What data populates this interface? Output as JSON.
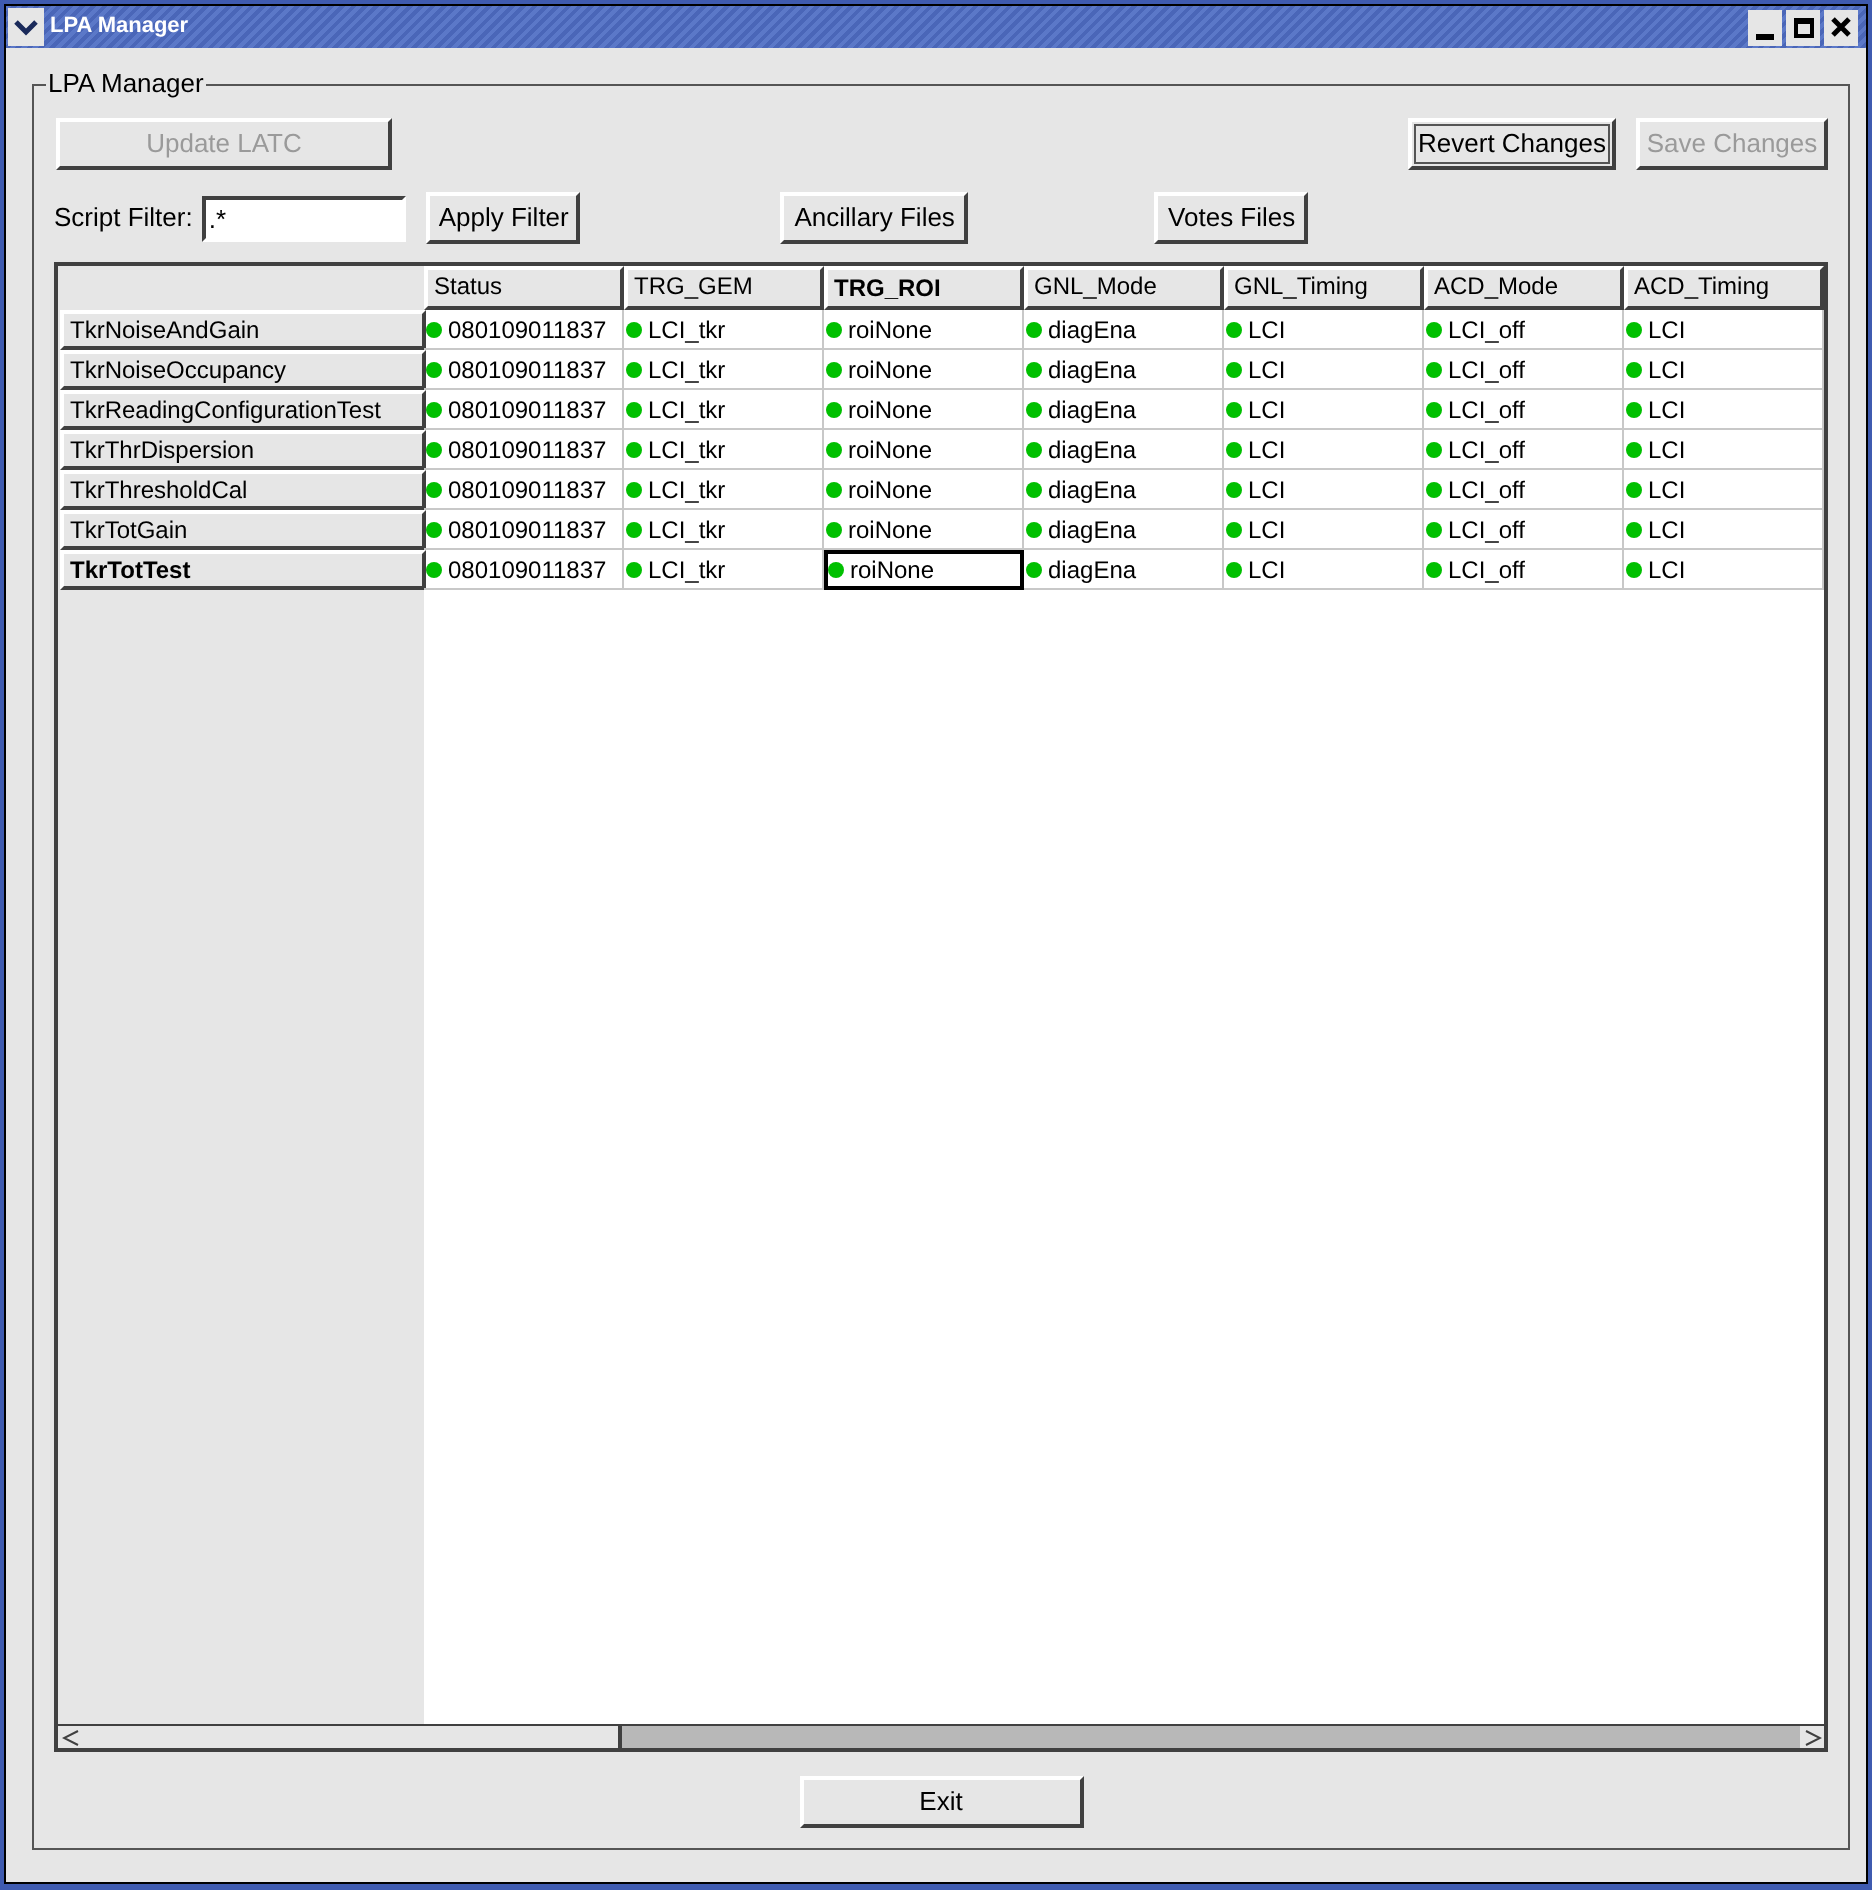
{
  "window": {
    "title": "LPA Manager"
  },
  "group": {
    "title": "LPA Manager"
  },
  "top_buttons": [
    {
      "label": "Update LATC",
      "disabled": true,
      "default": false
    },
    {
      "label": "Revert Changes",
      "disabled": false,
      "default": true
    },
    {
      "label": "Save Changes",
      "disabled": true,
      "default": false
    }
  ],
  "filter": {
    "label": "Script Filter:",
    "value": ".*"
  },
  "filter_buttons": [
    "Apply Filter",
    "Ancillary Files",
    "Votes Files"
  ],
  "table": {
    "columns": [
      {
        "label": "Status",
        "selected": false
      },
      {
        "label": "TRG_GEM",
        "selected": false
      },
      {
        "label": "TRG_ROI",
        "selected": true
      },
      {
        "label": "GNL_Mode",
        "selected": false
      },
      {
        "label": "GNL_Timing",
        "selected": false
      },
      {
        "label": "ACD_Mode",
        "selected": false
      },
      {
        "label": "ACD_Timing",
        "selected": false
      }
    ],
    "rows": [
      {
        "name": "TkrNoiseAndGain",
        "selected": false,
        "cells": [
          {
            "text": "080109011837",
            "selected": false
          },
          {
            "text": "LCI_tkr",
            "selected": false
          },
          {
            "text": "roiNone",
            "selected": false
          },
          {
            "text": "diagEna",
            "selected": false
          },
          {
            "text": "LCI",
            "selected": false
          },
          {
            "text": "LCI_off",
            "selected": false
          },
          {
            "text": "LCI",
            "selected": false
          }
        ]
      },
      {
        "name": "TkrNoiseOccupancy",
        "selected": false,
        "cells": [
          {
            "text": "080109011837",
            "selected": false
          },
          {
            "text": "LCI_tkr",
            "selected": false
          },
          {
            "text": "roiNone",
            "selected": false
          },
          {
            "text": "diagEna",
            "selected": false
          },
          {
            "text": "LCI",
            "selected": false
          },
          {
            "text": "LCI_off",
            "selected": false
          },
          {
            "text": "LCI",
            "selected": false
          }
        ]
      },
      {
        "name": "TkrReadingConfigurationTest",
        "selected": false,
        "cells": [
          {
            "text": "080109011837",
            "selected": false
          },
          {
            "text": "LCI_tkr",
            "selected": false
          },
          {
            "text": "roiNone",
            "selected": false
          },
          {
            "text": "diagEna",
            "selected": false
          },
          {
            "text": "LCI",
            "selected": false
          },
          {
            "text": "LCI_off",
            "selected": false
          },
          {
            "text": "LCI",
            "selected": false
          }
        ]
      },
      {
        "name": "TkrThrDispersion",
        "selected": false,
        "cells": [
          {
            "text": "080109011837",
            "selected": false
          },
          {
            "text": "LCI_tkr",
            "selected": false
          },
          {
            "text": "roiNone",
            "selected": false
          },
          {
            "text": "diagEna",
            "selected": false
          },
          {
            "text": "LCI",
            "selected": false
          },
          {
            "text": "LCI_off",
            "selected": false
          },
          {
            "text": "LCI",
            "selected": false
          }
        ]
      },
      {
        "name": "TkrThresholdCal",
        "selected": false,
        "cells": [
          {
            "text": "080109011837",
            "selected": false
          },
          {
            "text": "LCI_tkr",
            "selected": false
          },
          {
            "text": "roiNone",
            "selected": false
          },
          {
            "text": "diagEna",
            "selected": false
          },
          {
            "text": "LCI",
            "selected": false
          },
          {
            "text": "LCI_off",
            "selected": false
          },
          {
            "text": "LCI",
            "selected": false
          }
        ]
      },
      {
        "name": "TkrTotGain",
        "selected": false,
        "cells": [
          {
            "text": "080109011837",
            "selected": false
          },
          {
            "text": "LCI_tkr",
            "selected": false
          },
          {
            "text": "roiNone",
            "selected": false
          },
          {
            "text": "diagEna",
            "selected": false
          },
          {
            "text": "LCI",
            "selected": false
          },
          {
            "text": "LCI_off",
            "selected": false
          },
          {
            "text": "LCI",
            "selected": false
          }
        ]
      },
      {
        "name": "TkrTotTest",
        "selected": true,
        "cells": [
          {
            "text": "080109011837",
            "selected": false
          },
          {
            "text": "LCI_tkr",
            "selected": false
          },
          {
            "text": "roiNone",
            "selected": true
          },
          {
            "text": "diagEna",
            "selected": false
          },
          {
            "text": "LCI",
            "selected": false
          },
          {
            "text": "LCI_off",
            "selected": false
          },
          {
            "text": "LCI",
            "selected": false
          }
        ]
      }
    ]
  },
  "exit_button": "Exit"
}
